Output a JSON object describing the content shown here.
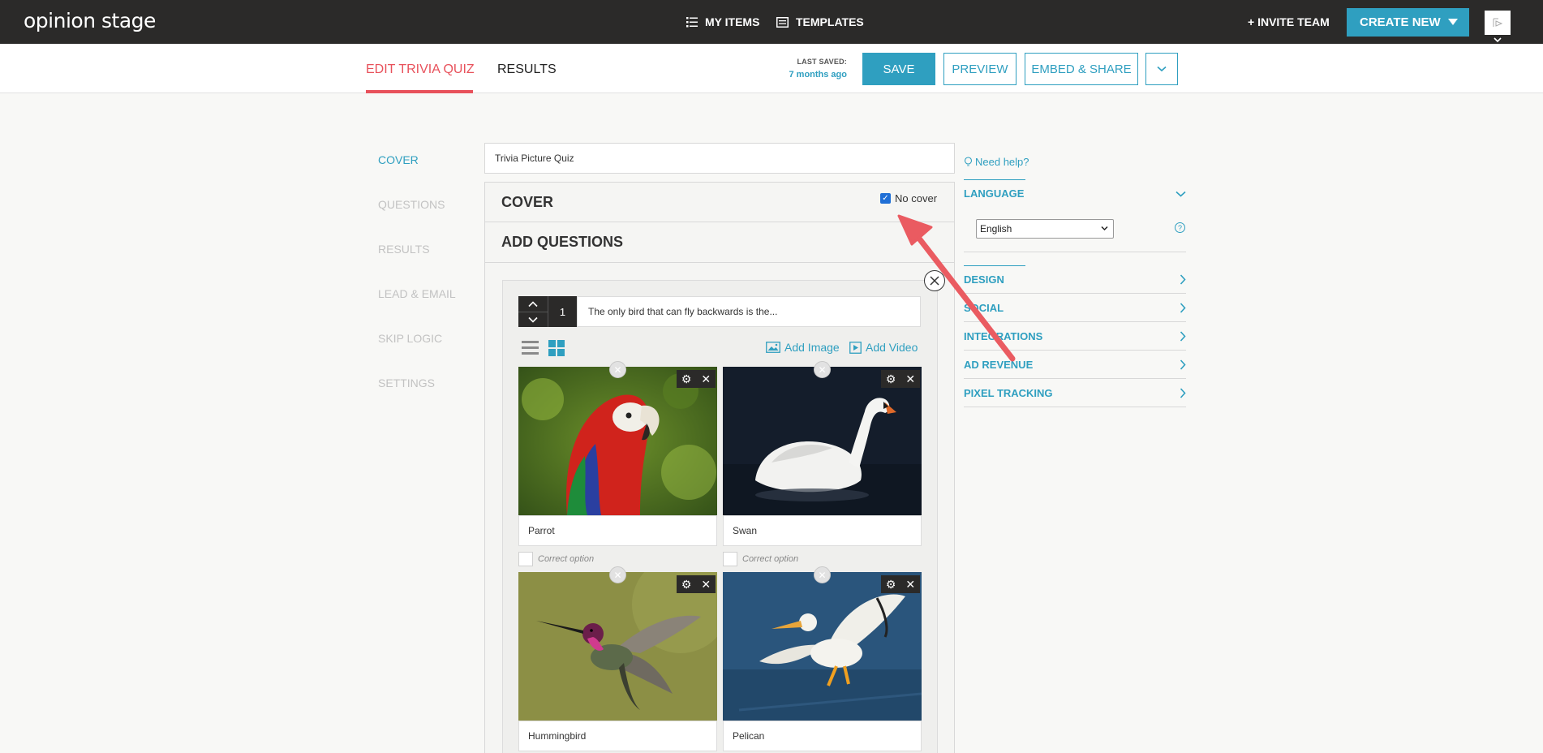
{
  "brand": {
    "logo_text": "opinion stage"
  },
  "topnav": {
    "my_items": "MY ITEMS",
    "templates": "TEMPLATES",
    "invite": "+ INVITE TEAM",
    "create_new": "CREATE NEW"
  },
  "editor_tabs": {
    "edit": "EDIT TRIVIA QUIZ",
    "results": "RESULTS"
  },
  "save_status": {
    "label": "LAST SAVED:",
    "value": "7 months ago"
  },
  "actions": {
    "save": "SAVE",
    "preview": "PREVIEW",
    "embed_share": "EMBED & SHARE"
  },
  "sidebar": {
    "items": [
      {
        "label": "COVER",
        "active": true
      },
      {
        "label": "QUESTIONS",
        "active": false
      },
      {
        "label": "RESULTS",
        "active": false
      },
      {
        "label": "LEAD & EMAIL",
        "active": false
      },
      {
        "label": "SKIP LOGIC",
        "active": false
      },
      {
        "label": "SETTINGS",
        "active": false
      }
    ]
  },
  "quiz": {
    "title": "Trivia Picture Quiz",
    "cover_heading": "COVER",
    "no_cover_label": "No cover",
    "no_cover_checked": true,
    "add_questions_heading": "ADD QUESTIONS",
    "question": {
      "number": "1",
      "text": "The only bird that can fly backwards is the..."
    },
    "add_image": "Add Image",
    "add_video": "Add Video",
    "correct_option_label": "Correct option",
    "options": [
      {
        "label": "Parrot"
      },
      {
        "label": "Swan"
      },
      {
        "label": "Hummingbird"
      },
      {
        "label": "Pelican"
      }
    ]
  },
  "right_panel": {
    "need_help": "Need help?",
    "language_heading": "LANGUAGE",
    "language_value": "English",
    "sections": [
      "DESIGN",
      "SOCIAL",
      "INTEGRATIONS",
      "AD REVENUE",
      "PIXEL TRACKING"
    ]
  },
  "colors": {
    "accent": "#2f9fc0",
    "active_tab": "#e8515b",
    "topbar": "#2b2a29",
    "annotation_arrow": "#ea5b61"
  }
}
